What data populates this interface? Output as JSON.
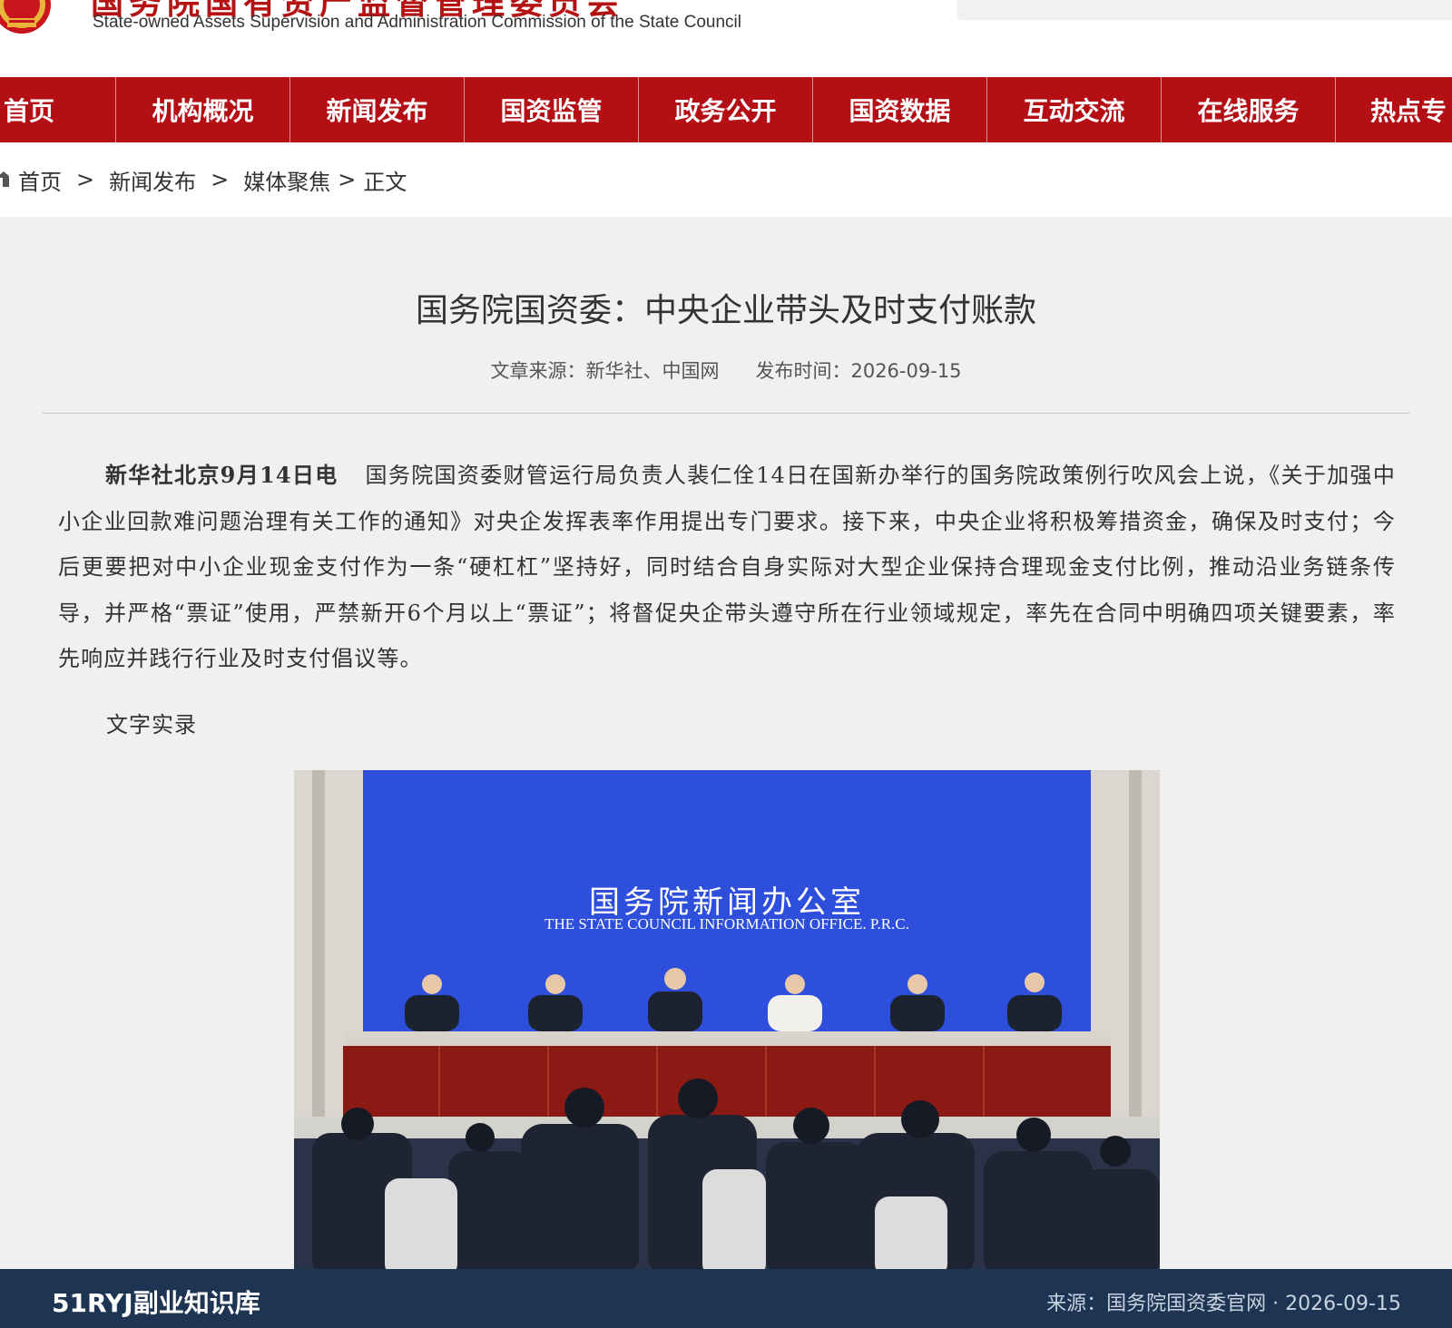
{
  "header": {
    "site_name_cn": "国务院国有资产监督管理委员会",
    "site_name_en": "State-owned Assets Supervision and Administration Commission of the State Council",
    "icons": {
      "emblem": "national-emblem",
      "search": "search-icon"
    }
  },
  "nav": {
    "items": [
      "首页",
      "机构概况",
      "新闻发布",
      "国资监管",
      "政务公开",
      "国资数据",
      "互动交流",
      "在线服务",
      "热点专"
    ]
  },
  "breadcrumb": {
    "home": "首页",
    "level1": "新闻发布",
    "level2": "媒体聚焦",
    "current": "正文",
    "separator": ">"
  },
  "article": {
    "title": "国务院国资委：中央企业带头及时支付账款",
    "source_label": "文章来源：新华社、中国网",
    "date_label": "发布时间：2026-09-15",
    "dateline": "新华社北京9月14日电",
    "body": "国务院国资委财管运行局负责人裴仁佺14日在国新办举行的国务院政策例行吹风会上说，《关于加强中小企业回款难问题治理有关工作的通知》对央企发挥表率作用提出专门要求。接下来，中央企业将积极筹措资金，确保及时支付；今后更要把对中小企业现金支付作为一条“硬杠杠”坚持好，同时结合自身实际对大型企业保持合理现金支付比例，推动沿业务链条传导，并严格“票证”使用，严禁新开6个月以上“票证”；将督促央企带头遵守所在行业领域规定，率先在合同中明确四项关键要素，率先响应并践行行业及时支付倡议等。",
    "subhead": "文字实录",
    "photo": {
      "backdrop_cn": "国务院新闻办公室",
      "backdrop_en": "THE STATE COUNCIL INFORMATION OFFICE. P.R.C."
    }
  },
  "footer": {
    "brand": "51RYJ副业知识库",
    "source": "来源：国务院国资委官网 · 2026-09-15"
  },
  "colors": {
    "nav_bg": "#b50f16",
    "footer_bg": "#1d3553",
    "page_bg": "#f0f0f0",
    "brand_red": "#b51313"
  }
}
